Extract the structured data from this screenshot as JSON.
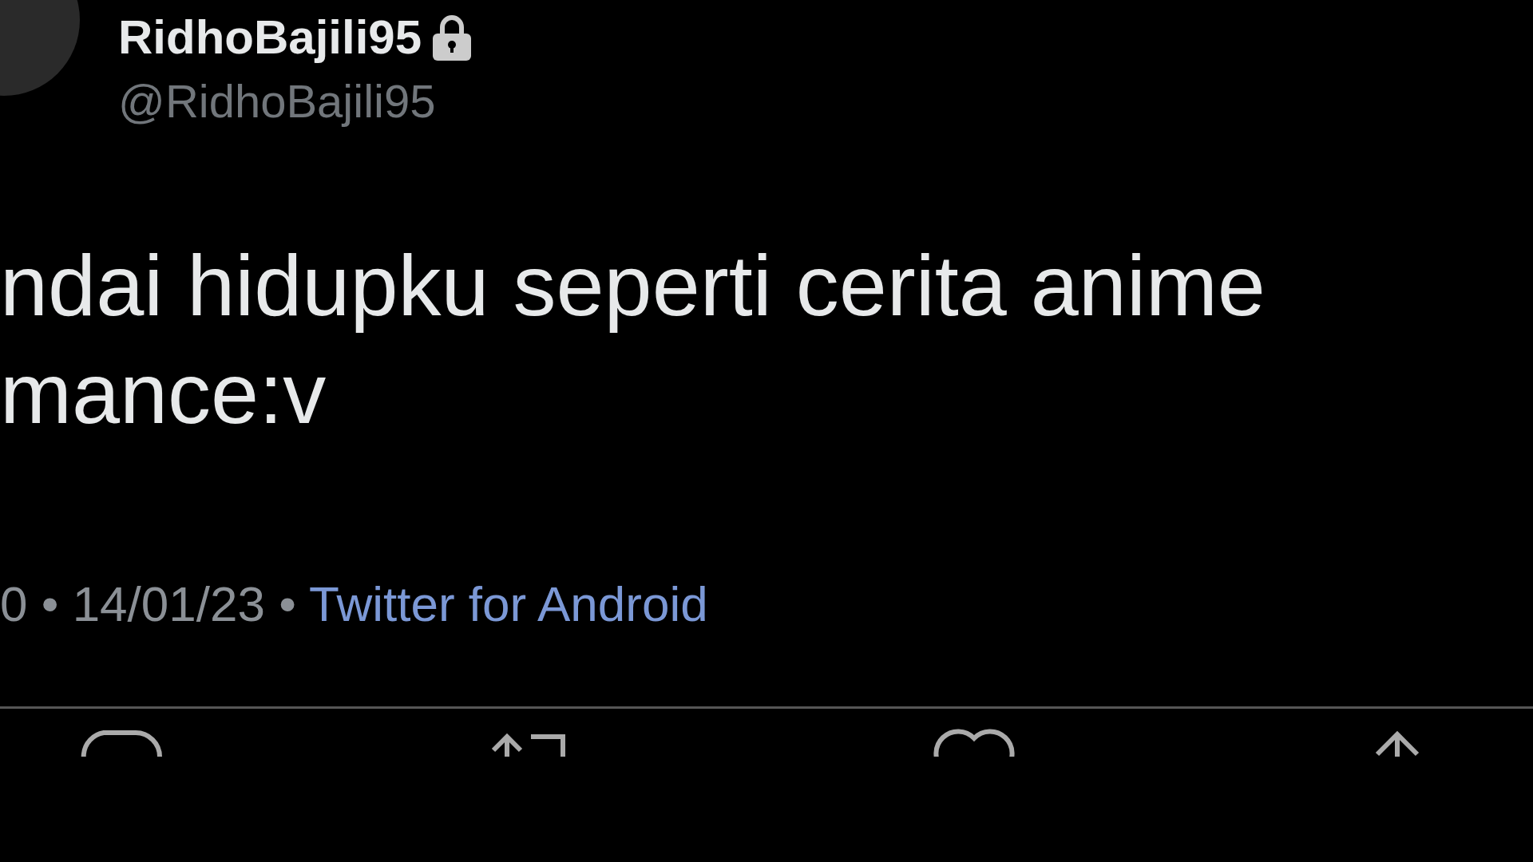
{
  "author": {
    "name": "RidhoBajili95",
    "protected": true,
    "handle": "@RidhoBajili95"
  },
  "tweet": {
    "lines": [
      "ndai hidupku seperti cerita anime",
      "mance:v"
    ]
  },
  "meta": {
    "time_date": "0 • 14/01/23 •",
    "source": "Twitter for Android"
  },
  "actions": [
    {
      "kind": "reply"
    },
    {
      "kind": "retweet"
    },
    {
      "kind": "like"
    },
    {
      "kind": "share"
    }
  ]
}
